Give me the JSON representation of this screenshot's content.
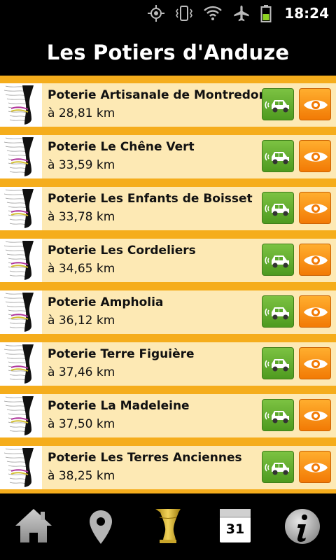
{
  "status_bar": {
    "time": "18:24",
    "icons": [
      "gps-icon",
      "vibrate-icon",
      "wifi-icon",
      "airplane-icon",
      "battery-icon"
    ]
  },
  "app": {
    "title": "Les Potiers d'Anduze"
  },
  "potters": [
    {
      "name": "Poterie Artisanale de Montredon",
      "distance": "à 28,81 km"
    },
    {
      "name": "Poterie Le Chêne Vert",
      "distance": "à 33,59 km"
    },
    {
      "name": "Poterie Les Enfants de Boisset",
      "distance": "à 33,78 km"
    },
    {
      "name": "Poterie Les Cordeliers",
      "distance": "à 34,65 km"
    },
    {
      "name": "Poterie Ampholia",
      "distance": "à 36,12 km"
    },
    {
      "name": "Poterie Terre Figuière",
      "distance": "à 37,46 km"
    },
    {
      "name": "Poterie La Madeleine",
      "distance": "à 37,50 km"
    },
    {
      "name": "Poterie Les Terres Anciennes",
      "distance": "à 38,25 km"
    }
  ],
  "row_actions": {
    "drive_icon": "car-icon",
    "view_icon": "eye-icon"
  },
  "bottom_nav": {
    "items": [
      "home-icon",
      "map-pin-icon",
      "vase-icon",
      "calendar-icon",
      "info-icon"
    ],
    "active": "vase-icon",
    "calendar_day": "31"
  },
  "colors": {
    "list_background": "#f5ad1c",
    "row_background": "#fde9b4",
    "drive_button": "#5aa82a",
    "view_button": "#f68a0c",
    "active_nav": "#e8c02e"
  }
}
